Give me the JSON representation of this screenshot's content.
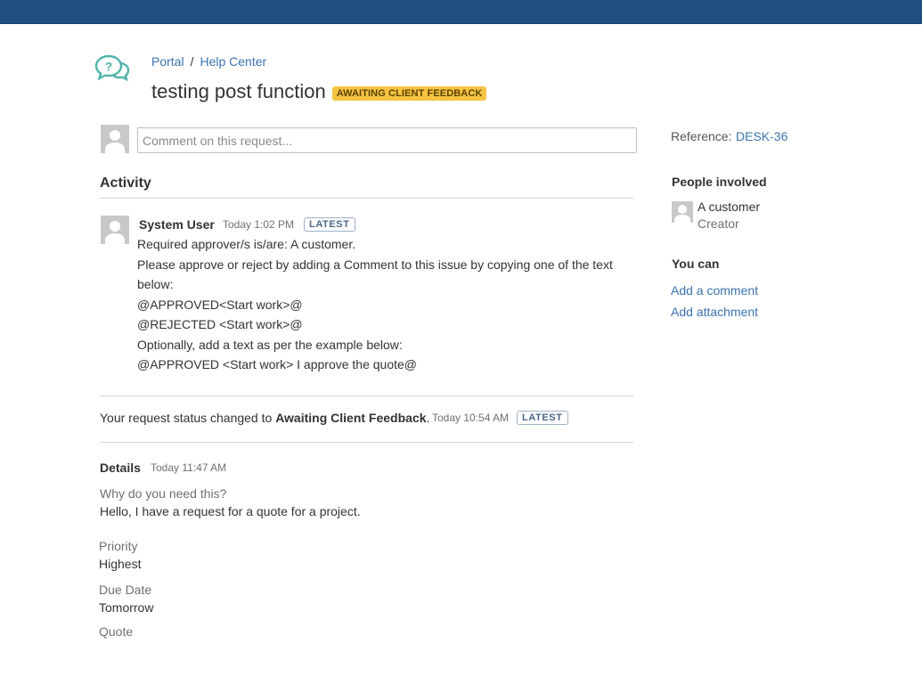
{
  "colors": {
    "header": "#205081",
    "link": "#3b73af",
    "status_lozenge": "#f6c342"
  },
  "logo": {
    "icon": "help-center-speech-bubbles-icon"
  },
  "breadcrumb": {
    "portal": "Portal",
    "separator": "/",
    "help_center": "Help Center"
  },
  "request": {
    "title": "testing post function",
    "status": "AWAITING CLIENT FEEDBACK"
  },
  "comment_box": {
    "placeholder": "Comment on this request..."
  },
  "activity": {
    "heading": "Activity",
    "entry": {
      "author": "System User",
      "time": "Today 1:02 PM",
      "badge": "LATEST",
      "lines": [
        "Required approver/s is/are: A customer.",
        "Please approve or reject by adding a Comment to this issue by copying one of the text below:",
        "@APPROVED<Start work>@",
        "@REJECTED <Start work>@",
        "Optionally, add a text as per the example below:",
        "@APPROVED <Start work> I approve the quote@"
      ]
    },
    "status_change": {
      "prefix": "Your request status changed to",
      "status": "Awaiting Client Feedback",
      "suffix": ".",
      "time": "Today 10:54 AM",
      "badge": "LATEST"
    },
    "details": {
      "heading": "Details",
      "time": "Today 11:47 AM",
      "fields": [
        {
          "label": "Why do you need this?",
          "value": "Hello, I have a request for a quote for a project."
        },
        {
          "label": "Priority",
          "value": "Highest"
        },
        {
          "label": "Due Date",
          "value": "Tomorrow"
        },
        {
          "label": "Quote",
          "value": ""
        }
      ]
    }
  },
  "sidebar": {
    "reference_label": "Reference:",
    "reference_value": "DESK-36",
    "people_heading": "People involved",
    "person": {
      "name": "A customer",
      "role": "Creator"
    },
    "you_can_heading": "You can",
    "actions": [
      "Add a comment",
      "Add attachment"
    ]
  }
}
